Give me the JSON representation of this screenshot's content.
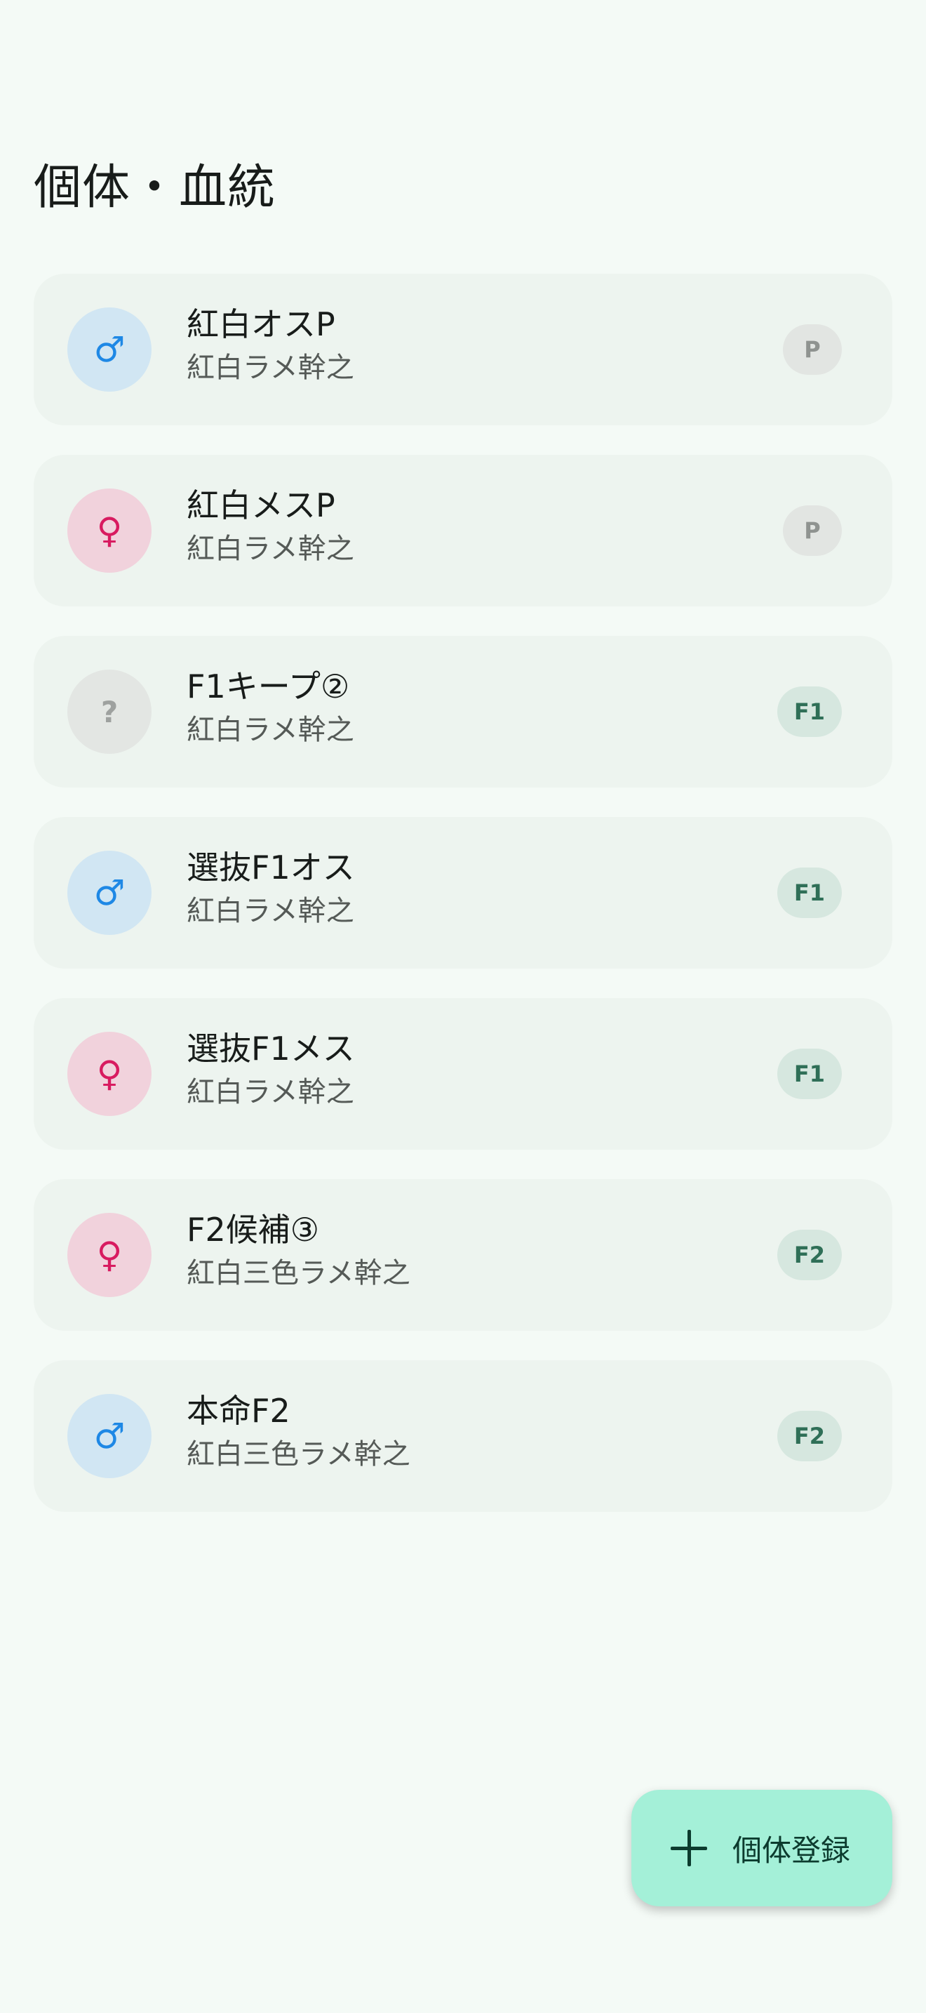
{
  "header": {
    "title": "個体・血統"
  },
  "icons": {
    "male": "♂",
    "female": "♀",
    "unknown": "?"
  },
  "individuals": [
    {
      "name": "紅白オスP",
      "lineage": "紅白ラメ幹之",
      "sex": "male",
      "generation": "P"
    },
    {
      "name": "紅白メスP",
      "lineage": "紅白ラメ幹之",
      "sex": "female",
      "generation": "P"
    },
    {
      "name": "F1キープ②",
      "lineage": "紅白ラメ幹之",
      "sex": "unknown",
      "generation": "F1"
    },
    {
      "name": "選抜F1オス",
      "lineage": "紅白ラメ幹之",
      "sex": "male",
      "generation": "F1"
    },
    {
      "name": "選抜F1メス",
      "lineage": "紅白ラメ幹之",
      "sex": "female",
      "generation": "F1"
    },
    {
      "name": "F2候補③",
      "lineage": "紅白三色ラメ幹之",
      "sex": "female",
      "generation": "F2"
    },
    {
      "name": "本命F2",
      "lineage": "紅白三色ラメ幹之",
      "sex": "male",
      "generation": "F2"
    }
  ],
  "fab": {
    "label": "個体登録",
    "icon": "plus-icon"
  },
  "colors": {
    "background": "#f4faf6",
    "card": "#edf4ef",
    "male_bg": "#d1e6f3",
    "male_fg": "#1e88e5",
    "female_bg": "#f1d2dc",
    "female_fg": "#d81b60",
    "fab_bg": "#a4f0d8"
  }
}
